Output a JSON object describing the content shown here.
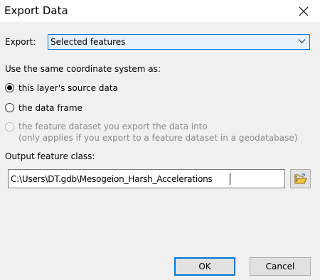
{
  "window": {
    "title": "Export Data",
    "close_icon": "close-icon"
  },
  "export": {
    "label": "Export:",
    "selected": "Selected features"
  },
  "coordinate": {
    "heading": "Use the same coordinate system as:",
    "options": [
      {
        "label": "this layer's source data",
        "checked": true,
        "enabled": true
      },
      {
        "label": "the data frame",
        "checked": false,
        "enabled": true
      },
      {
        "label": "the feature dataset you export the data into",
        "note": "(only applies if you export to a feature dataset in a geodatabase)",
        "checked": false,
        "enabled": false
      }
    ]
  },
  "output": {
    "label": "Output feature class:",
    "value": "C:\\Users\\DT.gdb\\Mesogeion_Harsh_Accelerations",
    "browse_icon": "open-folder-icon"
  },
  "buttons": {
    "ok": "OK",
    "cancel": "Cancel"
  },
  "colors": {
    "accent": "#0078d7",
    "dialog_bg": "#f0f0f0",
    "combo_bg": "#e5f1fb",
    "disabled_text": "#8a8a8a"
  }
}
